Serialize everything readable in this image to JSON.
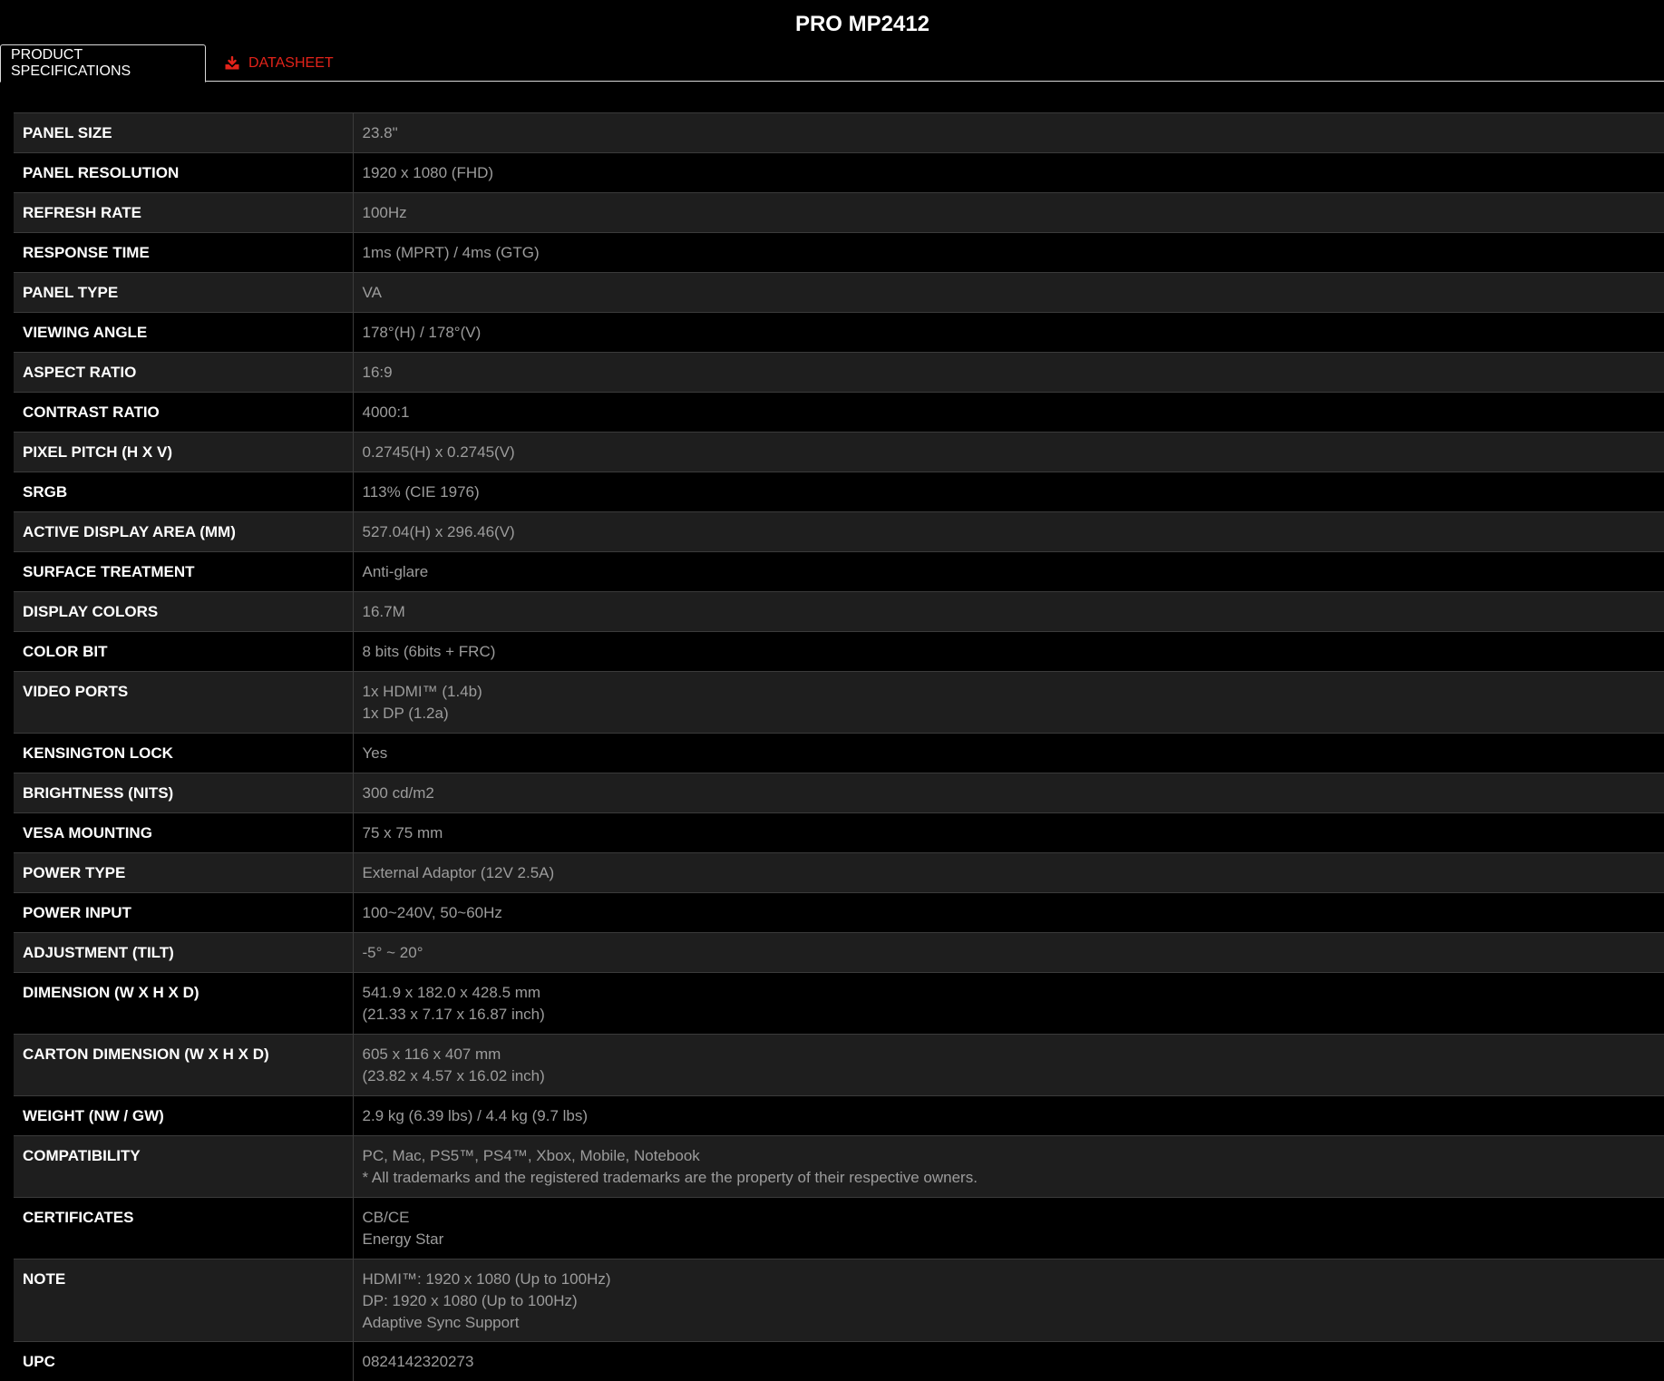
{
  "page_title": "PRO MP2412",
  "tabs": {
    "specs_label": "PRODUCT SPECIFICATIONS",
    "datasheet_label": "DATASHEET",
    "datasheet_icon": "download-icon",
    "datasheet_color": "#e2231a"
  },
  "specs": [
    {
      "label": "PANEL SIZE",
      "lines": [
        "23.8\""
      ]
    },
    {
      "label": "PANEL RESOLUTION",
      "lines": [
        "1920 x 1080 (FHD)"
      ]
    },
    {
      "label": "REFRESH RATE",
      "lines": [
        "100Hz"
      ]
    },
    {
      "label": "RESPONSE TIME",
      "lines": [
        "1ms (MPRT) / 4ms (GTG)"
      ]
    },
    {
      "label": "PANEL TYPE",
      "lines": [
        "VA"
      ]
    },
    {
      "label": "VIEWING ANGLE",
      "lines": [
        "178°(H) / 178°(V)"
      ]
    },
    {
      "label": "ASPECT RATIO",
      "lines": [
        "16:9"
      ]
    },
    {
      "label": "CONTRAST RATIO",
      "lines": [
        "4000:1"
      ]
    },
    {
      "label": "PIXEL PITCH (H X V)",
      "lines": [
        "0.2745(H) x 0.2745(V)"
      ]
    },
    {
      "label": "SRGB",
      "lines": [
        "113% (CIE 1976)"
      ]
    },
    {
      "label": "ACTIVE DISPLAY AREA (MM)",
      "lines": [
        "527.04(H) x 296.46(V)"
      ]
    },
    {
      "label": "SURFACE TREATMENT",
      "lines": [
        "Anti-glare"
      ]
    },
    {
      "label": "DISPLAY COLORS",
      "lines": [
        "16.7M"
      ]
    },
    {
      "label": "COLOR BIT",
      "lines": [
        "8 bits (6bits + FRC)"
      ]
    },
    {
      "label": "VIDEO PORTS",
      "lines": [
        "1x HDMI™ (1.4b)",
        "1x DP (1.2a)"
      ]
    },
    {
      "label": "KENSINGTON LOCK",
      "lines": [
        "Yes"
      ]
    },
    {
      "label": "BRIGHTNESS (NITS)",
      "lines": [
        "300 cd/m2"
      ]
    },
    {
      "label": "VESA MOUNTING",
      "lines": [
        "75 x 75 mm"
      ]
    },
    {
      "label": "POWER TYPE",
      "lines": [
        "External Adaptor (12V 2.5A)"
      ]
    },
    {
      "label": "POWER INPUT",
      "lines": [
        "100~240V, 50~60Hz"
      ]
    },
    {
      "label": "ADJUSTMENT (TILT)",
      "lines": [
        "-5° ~ 20°"
      ]
    },
    {
      "label": "DIMENSION (W X H X D)",
      "lines": [
        "541.9 x 182.0 x 428.5 mm",
        "(21.33 x 7.17 x 16.87 inch)"
      ]
    },
    {
      "label": "CARTON DIMENSION (W X H X D)",
      "lines": [
        "605 x 116 x 407 mm",
        "(23.82 x 4.57 x 16.02 inch)"
      ]
    },
    {
      "label": "WEIGHT (NW / GW)",
      "lines": [
        "2.9 kg (6.39 lbs) / 4.4 kg (9.7 lbs)"
      ]
    },
    {
      "label": "COMPATIBILITY",
      "lines": [
        "PC, Mac, PS5™, PS4™, Xbox, Mobile, Notebook",
        "* All trademarks and the registered trademarks are the property of their respective owners."
      ]
    },
    {
      "label": "CERTIFICATES",
      "lines": [
        "CB/CE",
        "Energy Star"
      ]
    },
    {
      "label": "NOTE",
      "lines": [
        "HDMI™: 1920 x 1080 (Up to 100Hz)",
        "DP: 1920 x 1080 (Up to 100Hz)",
        "Adaptive Sync Support"
      ]
    },
    {
      "label": "UPC",
      "lines": [
        "0824142320273"
      ]
    }
  ]
}
